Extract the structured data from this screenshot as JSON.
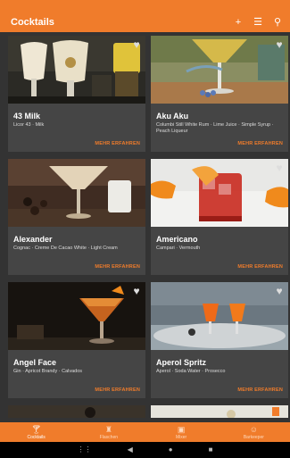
{
  "appbar": {
    "title": "Cocktails",
    "icons": [
      "plus-icon",
      "filter-icon",
      "search-icon"
    ]
  },
  "cards": [
    {
      "name": "43 Milk",
      "ingredients": "Licor 43 · Milk",
      "more": "MEHR ERFAHREN"
    },
    {
      "name": "Aku Aku",
      "ingredients": "Columbi Still White Rum · Lime Juice · Simple Syrup · Peach Liqueur",
      "more": "MEHR ERFAHREN"
    },
    {
      "name": "Alexander",
      "ingredients": "Cognac · Creme De Cacao White · Light Cream",
      "more": "MEHR ERFAHREN"
    },
    {
      "name": "Americano",
      "ingredients": "Campari · Vermouth",
      "more": "MEHR ERFAHREN"
    },
    {
      "name": "Angel Face",
      "ingredients": "Gin · Apricot Brandy · Calvados",
      "more": "MEHR ERFAHREN"
    },
    {
      "name": "Aperol Spritz",
      "ingredients": "Aperol · Soda Water · Prosecco",
      "more": "MEHR ERFAHREN"
    }
  ],
  "bottomnav": [
    {
      "label": "Cocktails",
      "icon": "cocktail-glass-icon",
      "active": true
    },
    {
      "label": "Flaschen",
      "icon": "bottle-icon",
      "active": false
    },
    {
      "label": "Mixer",
      "icon": "mixer-icon",
      "active": false
    },
    {
      "label": "Barkeeper",
      "icon": "person-icon",
      "active": false
    }
  ],
  "colors": {
    "accent": "#F07C2B",
    "card": "#454545",
    "background": "#333333"
  }
}
